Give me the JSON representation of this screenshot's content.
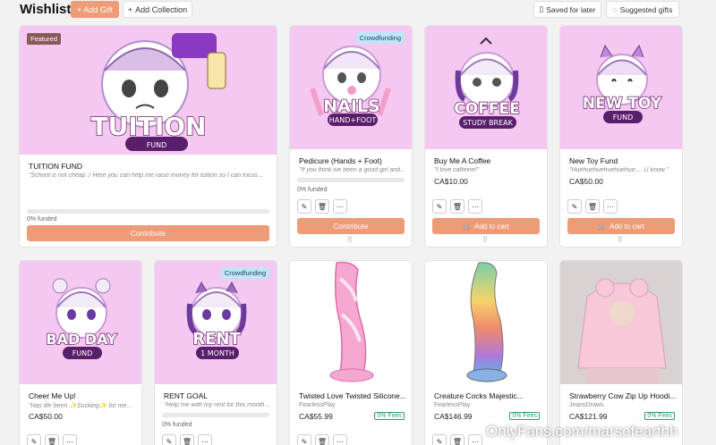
{
  "header": {
    "title": "Wishlist",
    "add_gift": "+ Add Gift",
    "add_collection": "Add Collection",
    "saved_for_later": "Saved for later",
    "suggested_gifts": "Suggested gifts"
  },
  "cards": [
    {
      "title": "TUITION FUND",
      "desc": "\"School is not cheap :/ Here you can help me raise money for tuition so I can focus...",
      "tag": "Featured",
      "funded": "0% funded",
      "cta": "Contribute",
      "image_big": "TUITION",
      "image_small": "FUND"
    },
    {
      "title": "Pedicure (Hands + Foot)",
      "desc": "\"If you think ive been a good girl and...",
      "tag": "Crowdfunding",
      "funded": "0% funded",
      "cta": "Contribute",
      "image_big": "NAILS",
      "image_small": "HAND+FOOT"
    },
    {
      "title": "Buy Me A Coffee",
      "desc": "\"I love caffeine!\"",
      "price": "CA$10.00",
      "cta": "Add to cart",
      "image_big": "COFFEE",
      "image_small": "STUDY BREAK"
    },
    {
      "title": "New Toy Fund",
      "desc": "\"Huehuehuehuehuehue.... U know.\"",
      "price": "CA$50.00",
      "cta": "Add to cart",
      "image_big": "NEW TOY",
      "image_small": "FUND"
    },
    {
      "title": "Cheer Me Up!",
      "desc": "\"Has life been ✨Sucking✨ for me? :...",
      "price": "CA$50.00",
      "image_big": "BAD DAY",
      "image_small": "FUND"
    },
    {
      "title": "RENT GOAL",
      "desc": "\"Help me with my rent for this month...",
      "tag": "Crowdfunding",
      "funded": "0% funded",
      "image_big": "RENT",
      "image_small": "1 MONTH"
    },
    {
      "title": "Twisted Love Twisted Silicone...",
      "store": "FearlessPlay",
      "price": "CA$55.99",
      "fees": "0% Fees"
    },
    {
      "title": "Creature Cocks Majestic...",
      "store": "FearlessPlay",
      "price": "CA$146.99",
      "fees": "0% Fees"
    },
    {
      "title": "Strawberry Cow Zip Up Hoodi...",
      "store": "JeansDraws",
      "price": "CA$121.99",
      "fees": "0% Fees"
    }
  ],
  "watermark": "OnlyFans.com/marsofearthh",
  "icons": {
    "edit": "pencil-icon",
    "delete": "trash-icon",
    "more": "more-icon",
    "cart": "cart-icon",
    "drag": "drag-handle-icon"
  },
  "colors": {
    "accent": "#ee9b78",
    "image_bg": "#f5c8f2",
    "fees_green": "#3a9a6a",
    "featured_tag": "#8a5a5a",
    "crowd_tag": "#bfe6f6"
  }
}
